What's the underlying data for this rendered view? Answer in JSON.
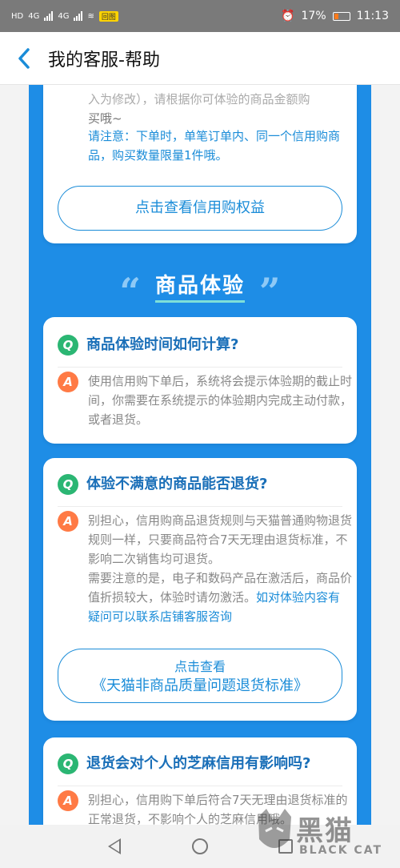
{
  "status_bar": {
    "left_label": "HD",
    "signal1": "4G",
    "signal2": "4G",
    "badge": "回图",
    "battery_percent": "17%",
    "time": "11:13"
  },
  "header": {
    "back_icon": "chevron-left-icon",
    "title": "我的客服-帮助"
  },
  "card_top": {
    "partial_text_cut": "入为修改），请根据你可体验的商品金额购",
    "partial_text": "买哦~",
    "notice": "请注意：下单时，单笔订单内、同一个信用购商品，购买数量限量1件哦。",
    "button_label": "点击查看信用购权益"
  },
  "section": {
    "title": "商品体验",
    "quote_open": "“",
    "quote_close": "”"
  },
  "faq": [
    {
      "q_badge": "Q",
      "question": "商品体验时间如何计算?",
      "a_badge": "A",
      "answer": "使用信用购下单后，系统将会提示体验期的截止时间，你需要在系统提示的体验期内完成主动付款，或者退货。"
    },
    {
      "q_badge": "Q",
      "question": "体验不满意的商品能否退货?",
      "a_badge": "A",
      "answer": "别担心，信用购商品退货规则与天猫普通购物退货规则一样，只要商品符合7天无理由退货标准，不影响二次销售均可退货。",
      "answer2": "需要注意的是，电子和数码产品在激活后，商品价值折损较大，体验时请勿激活。",
      "answer2_link": "如对体验内容有疑问可以联系店铺客服咨询",
      "button_line1": "点击查看",
      "button_line2": "《天猫非商品质量问题退货标准》"
    },
    {
      "q_badge": "Q",
      "question": "退货会对个人的芝麻信用有影响吗?",
      "a_badge": "A",
      "answer": "别担心，信用购下单后符合7天无理由退货标准的正常退货，不影响个人的芝麻信用哦。"
    }
  ],
  "watermark": {
    "text": "黑猫",
    "subtext": "BLACK CAT"
  },
  "colors": {
    "primary": "#1a8cd8",
    "panel_bg": "#1e8de6",
    "q_badge": "#2bb673",
    "a_badge": "#ff7a45"
  }
}
